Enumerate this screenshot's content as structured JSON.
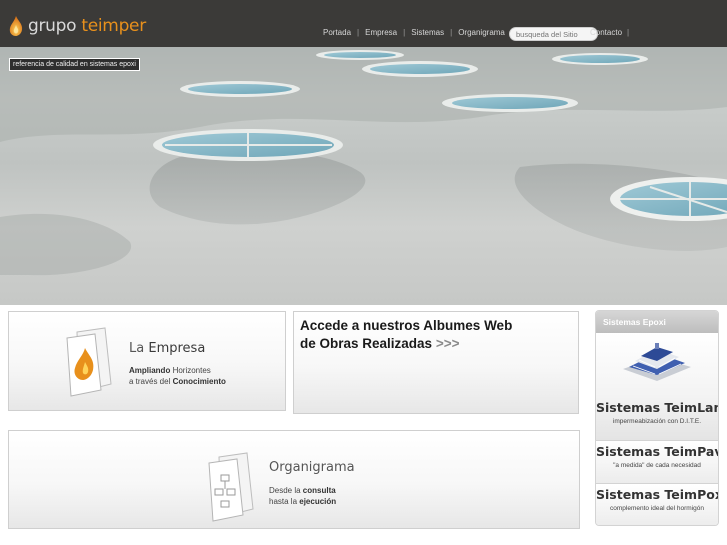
{
  "brand": {
    "word1": "grupo",
    "word2": "teimper"
  },
  "nav": {
    "items": [
      "Portada",
      "Empresa",
      "Sistemas",
      "Organigrama"
    ],
    "separator": "|",
    "contacto": "Contacto"
  },
  "search": {
    "placeholder": "busqueda del Sitio"
  },
  "hero": {
    "tag": "referencia de calidad en sistemas epoxi"
  },
  "empresa": {
    "title_pre": "La",
    "title_main": "Empresa",
    "line1_bold": "Ampliando",
    "line1_rest": " Horizontes",
    "line2_pre": "a través del ",
    "line2_bold": "Conocimiento"
  },
  "albumes": {
    "line1": "Accede a nuestros Albumes Web",
    "line2": "de Obras Realizadas",
    "arrow": " >>>"
  },
  "organigrama": {
    "title": "Organigrama",
    "line1_pre": "Desde la ",
    "line1_bold": "consulta",
    "line2_pre": "hasta la ",
    "line2_bold": "ejecución"
  },
  "sidebar": {
    "heading": "Sistemas Epoxi",
    "systems": [
      {
        "title": "Sistemas TeimLam",
        "subtitle": "impermeabización con D.I.T.E."
      },
      {
        "title": "Sistemas TeimPav",
        "subtitle": "\"a medida\" de cada necesidad"
      },
      {
        "title": "Sistemas TeimPox",
        "subtitle": "complemento ideal del hormigón"
      }
    ]
  },
  "colors": {
    "header_bg": "#3b3a38",
    "brand_accent": "#e8901c"
  }
}
